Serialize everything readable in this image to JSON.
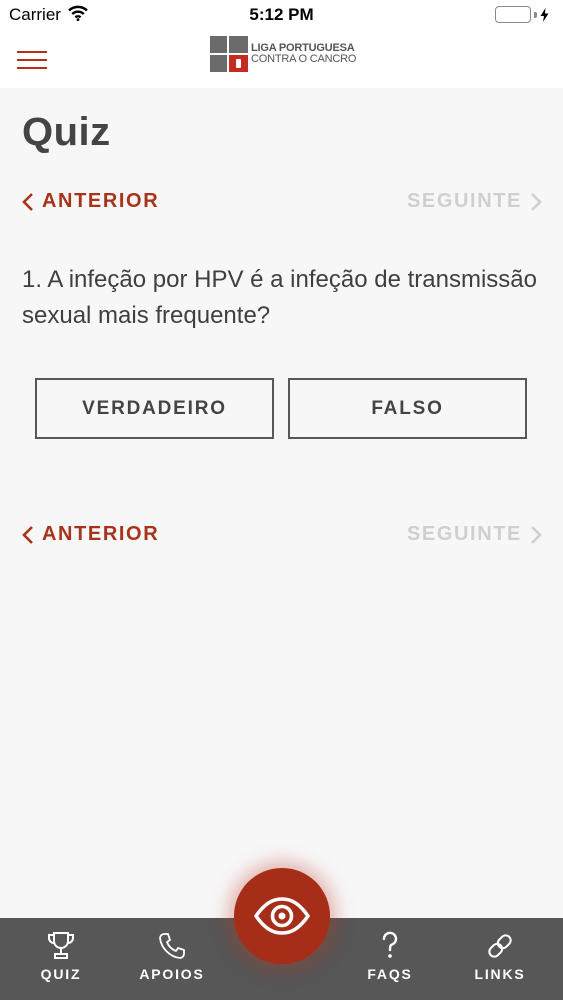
{
  "status_bar": {
    "carrier": "Carrier",
    "time": "5:12 PM",
    "battery_level": 1.0
  },
  "nav": {
    "logo_line1": "LIGA PORTUGUESA",
    "logo_line2": "CONTRA O CANCRO"
  },
  "page": {
    "title": "Quiz"
  },
  "pager": {
    "prev_label": "ANTERIOR",
    "next_label": "SEGUINTE"
  },
  "question": {
    "text": "1. A infeção por HPV é a infeção de transmissão sexual mais frequente?"
  },
  "answers": {
    "true_label": "VERDADEIRO",
    "false_label": "FALSO"
  },
  "tabs": {
    "quiz_label": "QUIZ",
    "apoios_label": "APOIOS",
    "faqs_label": "FAQS",
    "links_label": "LINKS"
  },
  "colors": {
    "accent": "#a8331a",
    "disabled": "#cfcfd2",
    "tab_bar": "#575757",
    "battery": "#4cd964"
  },
  "icons": [
    "wifi-icon",
    "battery-icon",
    "hamburger-icon",
    "chevron-left-icon",
    "chevron-right-icon",
    "trophy-icon",
    "phone-icon",
    "eye-icon",
    "question-icon",
    "link-icon"
  ]
}
